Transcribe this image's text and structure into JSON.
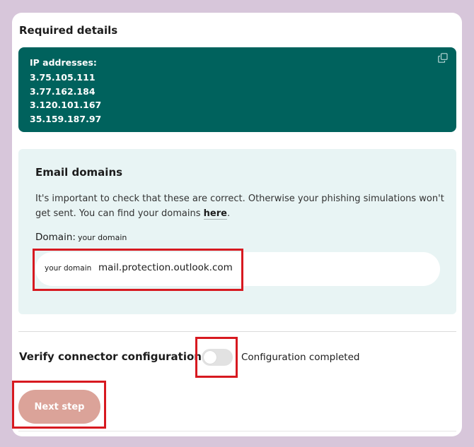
{
  "required_details": {
    "title": "Required details",
    "ip_box": {
      "heading": "IP addresses:",
      "addresses": [
        "3.75.105.111",
        "3.77.162.184",
        "3.120.101.167",
        "35.159.187.97"
      ],
      "copy_icon": "copy-icon"
    }
  },
  "email_domains": {
    "title": "Email domains",
    "description": "It's important to check that these are correct. Otherwise your phishing simulations won't get sent. You can find your domains ",
    "link_text": "here",
    "description_end": ".",
    "domain_label": "Domain:",
    "domain_placeholder": "your domain",
    "field_prefix": "your domain",
    "field_suffix": "mail.protection.outlook.com"
  },
  "verify": {
    "label": "Verify connector configuration",
    "toggle_label": "Configuration completed",
    "toggle_on": false
  },
  "actions": {
    "next_label": "Next step"
  },
  "colors": {
    "ip_box_bg": "#00625d",
    "email_box_bg": "#e8f4f4",
    "next_button_bg": "#dba399",
    "highlight_red": "#d71920"
  }
}
